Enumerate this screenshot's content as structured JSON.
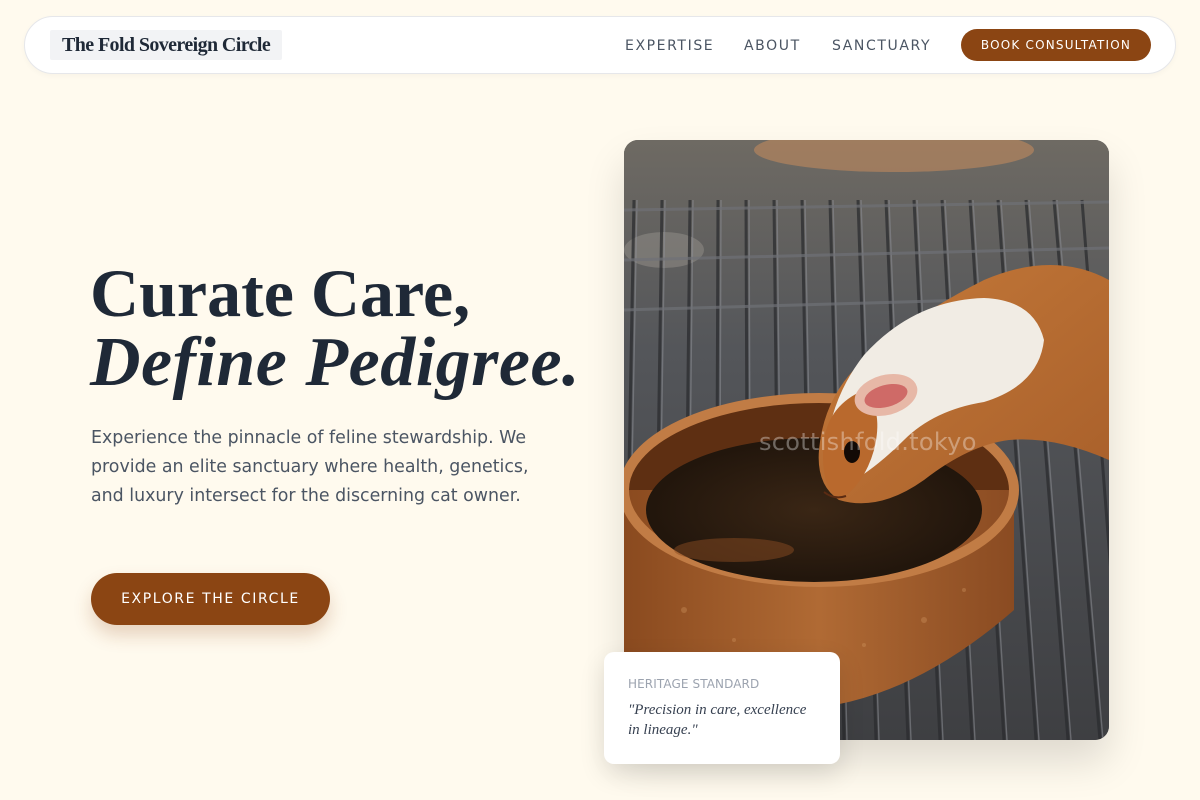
{
  "brand": {
    "name": "The Fold Sovereign Circle",
    "accent": "#8b4513",
    "background": "#fffaee",
    "text": "#1f2937"
  },
  "nav": {
    "links": [
      "EXPERTISE",
      "ABOUT",
      "SANCTUARY"
    ],
    "cta": "BOOK CONSULTATION"
  },
  "hero": {
    "title_line1": "Curate Care,",
    "title_line2": "Define Pedigree.",
    "description": "Experience the pinnacle of feline stewardship. We provide an elite sanctuary where health, genetics, and luxury intersect for the discerning cat owner.",
    "cta": "EXPLORE THE CIRCLE",
    "image_watermark": "scottishfold.tokyo"
  },
  "quote_card": {
    "label": "HERITAGE STANDARD",
    "text": "\"Precision in care, excellence in lineage.\""
  }
}
